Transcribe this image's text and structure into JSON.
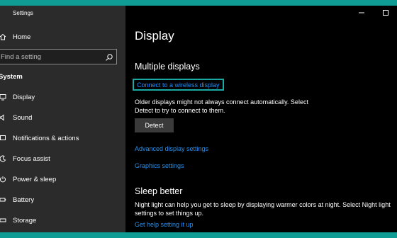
{
  "app_title": "Settings",
  "sidebar": {
    "home": {
      "label": "Home",
      "icon": "home-icon"
    },
    "search": {
      "placeholder": "Find a setting",
      "icon": "search-icon"
    },
    "section_label": "System",
    "items": [
      {
        "label": "Display",
        "icon": "display-icon"
      },
      {
        "label": "Sound",
        "icon": "sound-icon"
      },
      {
        "label": "Notifications & actions",
        "icon": "notifications-icon"
      },
      {
        "label": "Focus assist",
        "icon": "focus-assist-icon"
      },
      {
        "label": "Power & sleep",
        "icon": "power-icon"
      },
      {
        "label": "Battery",
        "icon": "battery-icon"
      },
      {
        "label": "Storage",
        "icon": "storage-icon"
      }
    ]
  },
  "main": {
    "title": "Display",
    "multiple_displays": {
      "heading": "Multiple displays",
      "wireless_link": "Connect to a wireless display",
      "note_line1": "Older displays might not always connect automatically. Select",
      "note_line2": "Detect to try to connect to them.",
      "detect_button": "Detect",
      "advanced_link": "Advanced display settings",
      "graphics_link": "Graphics settings"
    },
    "sleep_better": {
      "heading": "Sleep better",
      "text_line1": "Night light can help you get to sleep by displaying warmer colors at night. Select Night light",
      "text_line2": "settings to set things up.",
      "help_link": "Get help setting it up"
    }
  },
  "colors": {
    "accent": "#1e90ff",
    "focus_border": "#1aa9a3",
    "desktop": "#0f9c94",
    "sidebar_bg": "#2b2b2b",
    "main_bg": "#000000"
  }
}
